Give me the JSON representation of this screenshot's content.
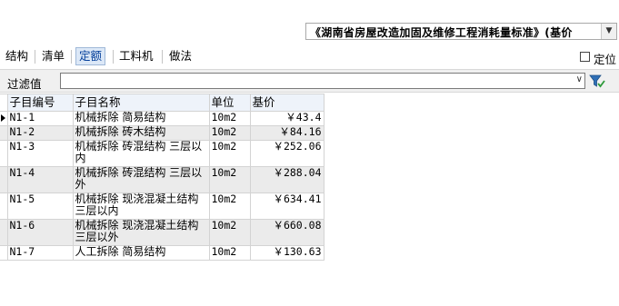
{
  "standard_selector": {
    "value": "《湖南省房屋改造加固及维修工程消耗量标准》(基价"
  },
  "tabs": [
    "结构",
    "清单",
    "定额",
    "工料机",
    "做法"
  ],
  "active_tab": "定额",
  "locate_label": "定位",
  "filter": {
    "label": "过滤值",
    "value": ""
  },
  "table": {
    "columns": [
      "子目编号",
      "子目名称",
      "单位",
      "基价"
    ],
    "rows": [
      {
        "code": "N1-1",
        "name": "机械拆除 简易结构",
        "unit": "10m2",
        "price": "￥43.4"
      },
      {
        "code": "N1-2",
        "name": "机械拆除 砖木结构",
        "unit": "10m2",
        "price": "￥84.16"
      },
      {
        "code": "N1-3",
        "name": "机械拆除 砖混结构 三层以内",
        "unit": "10m2",
        "price": "￥252.06"
      },
      {
        "code": "N1-4",
        "name": "机械拆除 砖混结构 三层以外",
        "unit": "10m2",
        "price": "￥288.04"
      },
      {
        "code": "N1-5",
        "name": "机械拆除 现浇混凝土结构 三层以内",
        "unit": "10m2",
        "price": "￥634.41"
      },
      {
        "code": "N1-6",
        "name": "机械拆除 现浇混凝土结构 三层以外",
        "unit": "10m2",
        "price": "￥660.08"
      },
      {
        "code": "N1-7",
        "name": "人工拆除 简易结构",
        "unit": "10m2",
        "price": "￥130.63"
      }
    ]
  },
  "colors": {
    "active_tab_bg": "#dce8f7",
    "alt_row_bg": "#ebebeb",
    "header_bg": "#eef3fa",
    "filter_icon": "#2f6fb5"
  }
}
